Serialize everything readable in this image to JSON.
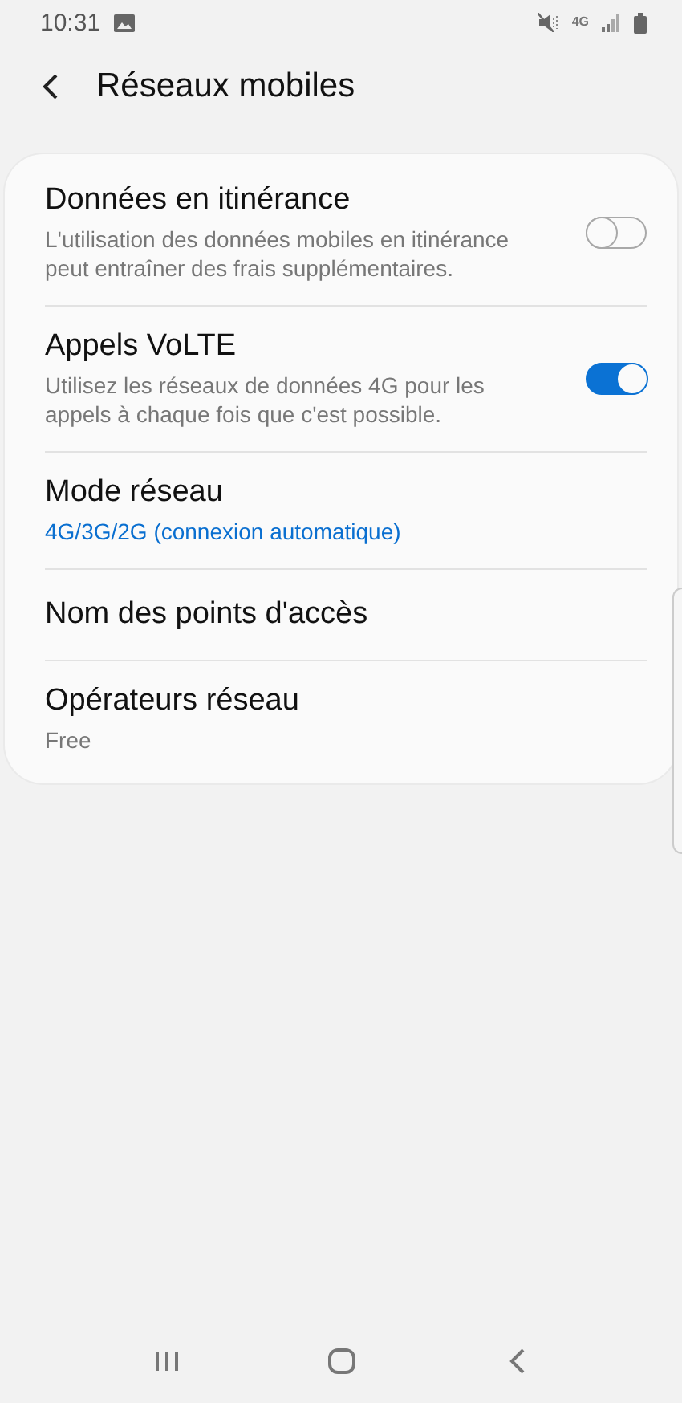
{
  "status_bar": {
    "time": "10:31",
    "network": "4G"
  },
  "header": {
    "title": "Réseaux mobiles"
  },
  "settings": [
    {
      "kind": "toggle",
      "title": "Données en itinérance",
      "summary": "L'utilisation des données mobiles en itinérance peut entraîner des frais supplémentaires.",
      "on": false
    },
    {
      "kind": "toggle",
      "title": "Appels VoLTE",
      "summary": "Utilisez les réseaux de données 4G pour les appels à chaque fois que c'est possible.",
      "on": true
    },
    {
      "kind": "value",
      "title": "Mode réseau",
      "summary": "4G/3G/2G (connexion automatique)"
    },
    {
      "kind": "plain",
      "title": "Nom des points d'accès"
    },
    {
      "kind": "summary",
      "title": "Opérateurs réseau",
      "summary": "Free"
    }
  ]
}
